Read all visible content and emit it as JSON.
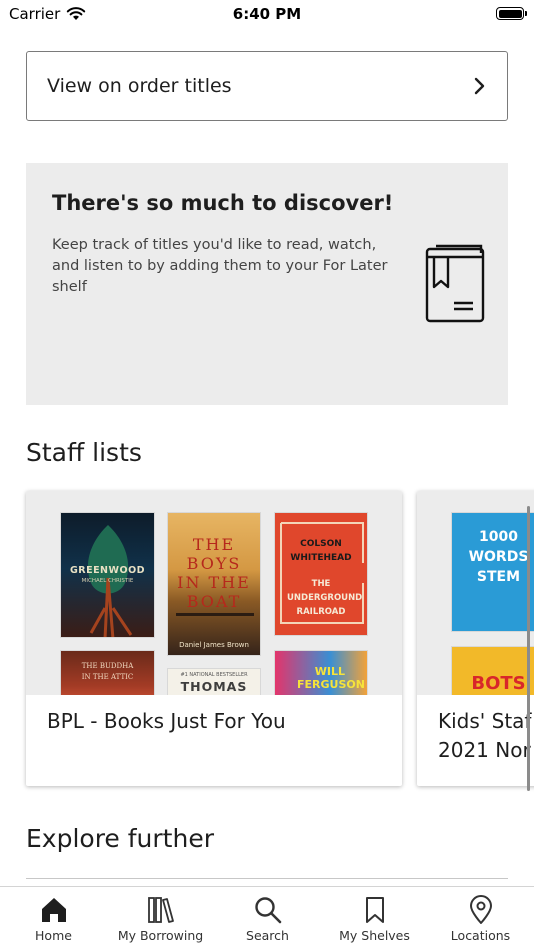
{
  "status_bar": {
    "carrier": "Carrier",
    "time": "6:40 PM"
  },
  "order_row": {
    "label": "View on order titles"
  },
  "discover": {
    "title": "There's so much to discover!",
    "body": "Keep track of titles you'd like to read, watch, and listen to by adding them to your For Later shelf"
  },
  "staff_lists": {
    "title": "Staff lists",
    "cards": [
      {
        "name": "BPL - Books Just For You",
        "covers": [
          {
            "title": "GREENWOOD",
            "author": "MICHAEL CHRISTIE"
          },
          {
            "title": "THE BOYS IN THE BOAT",
            "author": "Daniel James Brown"
          },
          {
            "title": "COLSON WHITEHEAD",
            "subtitle": "THE UNDERGROUND RAILROAD"
          },
          {
            "title": "THE BUDDHA IN THE ATTIC"
          },
          {
            "banner": "#1 NATIONAL BESTSELLER",
            "title": "THOMAS"
          },
          {
            "title": "WILL FERGUSON"
          }
        ]
      },
      {
        "name_line1": "Kids' Staf",
        "name_line2": "2021 Nor",
        "covers": [
          {
            "title": "1000 WORDS STEM"
          },
          {
            "title": "BOTS"
          }
        ]
      }
    ]
  },
  "explore": {
    "title": "Explore further"
  },
  "tabbar": {
    "items": [
      {
        "label": "Home",
        "icon": "home-icon"
      },
      {
        "label": "My Borrowing",
        "icon": "books-icon"
      },
      {
        "label": "Search",
        "icon": "search-icon"
      },
      {
        "label": "My Shelves",
        "icon": "bookmark-icon"
      },
      {
        "label": "Locations",
        "icon": "location-pin-icon"
      }
    ]
  }
}
